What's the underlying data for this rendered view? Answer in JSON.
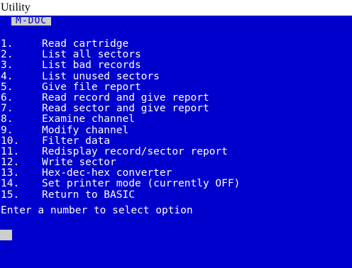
{
  "caption": "Utility",
  "screen": {
    "background_color": "#0000cc",
    "text_color": "#ffffff",
    "highlight_color": "#cdcdcd",
    "title": "M-DOC",
    "menu": [
      {
        "number": "1.",
        "label": "Read cartridge"
      },
      {
        "number": "2.",
        "label": "List all sectors"
      },
      {
        "number": "3.",
        "label": "List bad records"
      },
      {
        "number": "4.",
        "label": "List unused sectors"
      },
      {
        "number": "5.",
        "label": "Give file report"
      },
      {
        "number": "6.",
        "label": "Read record and give report"
      },
      {
        "number": "7.",
        "label": "Read sector and give report"
      },
      {
        "number": "8.",
        "label": "Examine channel"
      },
      {
        "number": "9.",
        "label": "Modify channel"
      },
      {
        "number": "10.",
        "label": "Filter data"
      },
      {
        "number": "11.",
        "label": "Redisplay record/sector report"
      },
      {
        "number": "12.",
        "label": "Write sector"
      },
      {
        "number": "13.",
        "label": "Hex-dec-hex converter"
      },
      {
        "number": "14.",
        "label": "Set printer mode (currently OFF)"
      },
      {
        "number": "15.",
        "label": "Return to BASIC"
      }
    ],
    "prompt": "Enter a number to select option",
    "input_value": ""
  }
}
